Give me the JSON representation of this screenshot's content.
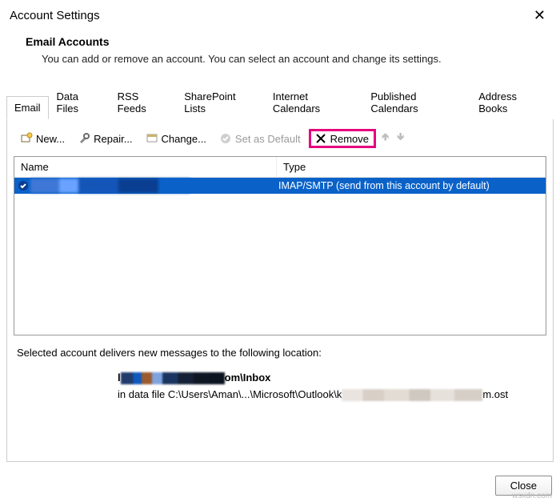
{
  "window": {
    "title": "Account Settings"
  },
  "intro": {
    "heading": "Email Accounts",
    "desc": "You can add or remove an account. You can select an account and change its settings."
  },
  "tabs": {
    "email": "Email",
    "datafiles": "Data Files",
    "rss": "RSS Feeds",
    "sharepoint": "SharePoint Lists",
    "ical": "Internet Calendars",
    "pubcal": "Published Calendars",
    "addr": "Address Books"
  },
  "toolbar": {
    "new": "New...",
    "repair": "Repair...",
    "change": "Change...",
    "setdefault": "Set as Default",
    "remove": "Remove"
  },
  "list": {
    "col_name": "Name",
    "col_type": "Type",
    "row_type": "IMAP/SMTP (send from this account by default)"
  },
  "selected_msg": "Selected account delivers new messages to the following location:",
  "location": {
    "line1_prefix": "l",
    "line1_suffix": "om\\Inbox",
    "line2_prefix": "in data file C:\\Users\\Aman\\...\\Microsoft\\Outlook\\k",
    "line2_suffix": "m.ost"
  },
  "footer": {
    "close": "Close"
  },
  "watermark": "wsxdn.com"
}
